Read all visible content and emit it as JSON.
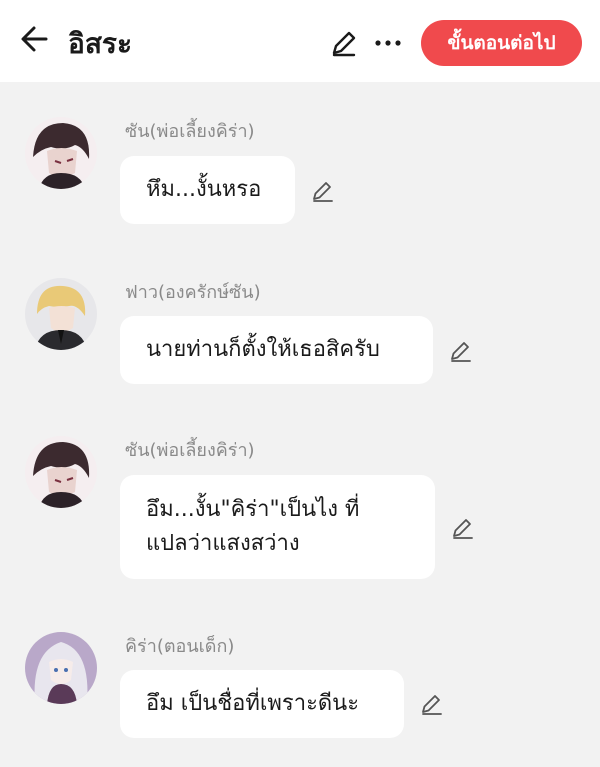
{
  "header": {
    "title": "อิสระ",
    "next_label": "ขั้นตอนต่อไป",
    "back_icon": "arrow-left-icon",
    "edit_icon": "pencil-icon",
    "more_icon": "ellipsis-icon"
  },
  "colors": {
    "accent": "#f04a4d",
    "background": "#f2f2f2",
    "bubble": "#ffffff",
    "name_text": "#8a8a8a"
  },
  "messages": [
    {
      "name": "ซัน(พ่อเลี้ยงคิร่า)",
      "text": "หึม...งั้นหรอ"
    },
    {
      "name": "ฟาว(องครักษ์ซัน)",
      "text": "นายท่านก็ตั้งให้เธอสิครับ"
    },
    {
      "name": "ซัน(พ่อเลี้ยงคิร่า)",
      "text": "อึม...งั้น\"คิร่า\"เป็นไง ที่\nแปลว่าแสงสว่าง"
    },
    {
      "name": "คิร่า(ตอนเด็ก)",
      "text": "อึม เป็นชื่อที่เพราะดีนะ"
    }
  ]
}
